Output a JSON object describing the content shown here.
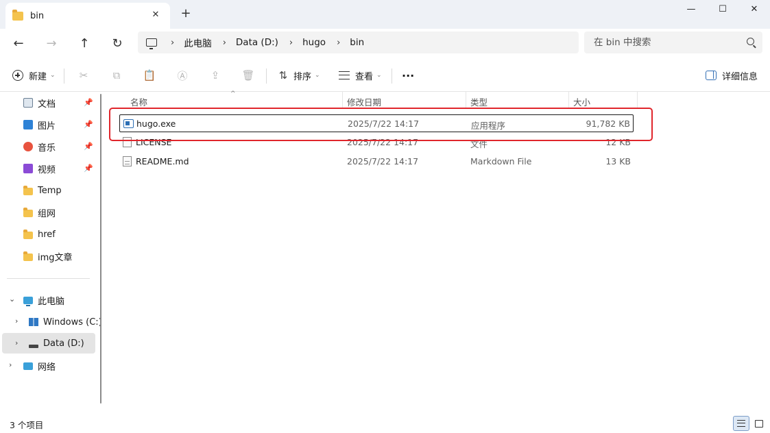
{
  "window": {
    "tab_title": "bin",
    "tab_close_glyph": "✕",
    "new_tab_glyph": "+",
    "minimize_glyph": "—",
    "maximize_glyph": "☐",
    "close_glyph": "✕"
  },
  "nav": {
    "back_glyph": "←",
    "forward_glyph": "→",
    "up_glyph": "↑",
    "refresh_glyph": "↻"
  },
  "breadcrumb": {
    "separator": "›",
    "items": [
      "此电脑",
      "Data (D:)",
      "hugo",
      "bin"
    ]
  },
  "search": {
    "placeholder": "在 bin 中搜索"
  },
  "toolbar": {
    "new_label": "新建",
    "sort_label": "排序",
    "view_label": "查看",
    "more_glyph": "···",
    "details_label": "详细信息",
    "caret": "⌄",
    "disabled_icons": {
      "cut": "✂",
      "copy": "⧉",
      "paste": "📋",
      "rename": "Ⓐ",
      "share": "⇪",
      "delete": "🗑"
    },
    "sort_icon": "⇅"
  },
  "sidebar": {
    "pin_glyph": "📌",
    "quick_access": [
      {
        "label": "文档",
        "icon": "document-icon",
        "pinned": true
      },
      {
        "label": "图片",
        "icon": "pictures-icon",
        "pinned": true
      },
      {
        "label": "音乐",
        "icon": "music-icon",
        "pinned": true
      },
      {
        "label": "视频",
        "icon": "video-icon",
        "pinned": true
      },
      {
        "label": "Temp",
        "icon": "folder-icon",
        "pinned": false
      },
      {
        "label": "组网",
        "icon": "folder-icon",
        "pinned": false
      },
      {
        "label": "href",
        "icon": "folder-icon",
        "pinned": false
      },
      {
        "label": "img文章",
        "icon": "folder-icon",
        "pinned": false
      }
    ],
    "this_pc": "此电脑",
    "drive_c": "Windows (C:)",
    "drive_d": "Data (D:)",
    "network": "网络",
    "expanded_chevron": "⌄",
    "collapsed_chevron": "›"
  },
  "columns": {
    "name": "名称",
    "date": "修改日期",
    "type": "类型",
    "size": "大小",
    "sort_indicator": "^"
  },
  "files": [
    {
      "name": "hugo.exe",
      "date": "2025/7/22 14:17",
      "type": "应用程序",
      "size": "91,782 KB",
      "icon": "exe-icon"
    },
    {
      "name": "LICENSE",
      "date": "2025/7/22 14:17",
      "type": "文件",
      "size": "12 KB",
      "icon": "file-icon"
    },
    {
      "name": "README.md",
      "date": "2025/7/22 14:17",
      "type": "Markdown File",
      "size": "13 KB",
      "icon": "markdown-file-icon"
    }
  ],
  "status": {
    "item_count": "3 个项目"
  },
  "colors": {
    "highlight": "#e0252b",
    "folder": "#f4c34d",
    "accent": "#336fb4",
    "titlebar": "#eef1f6"
  }
}
